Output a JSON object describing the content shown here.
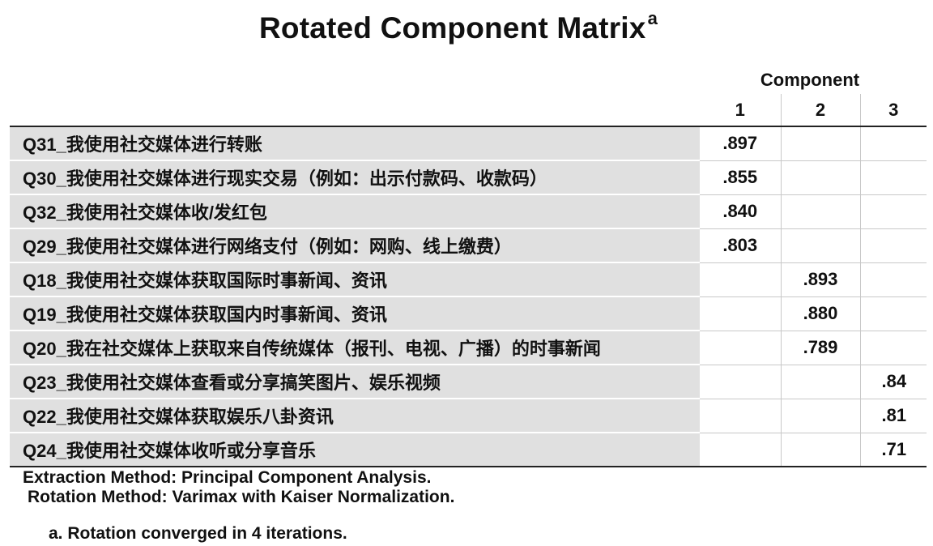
{
  "title": "Rotated Component Matrix",
  "title_superscript": "a",
  "component_header": "Component",
  "columns": [
    "1",
    "2",
    "3"
  ],
  "rows": [
    {
      "label": "Q31_我使用社交媒体进行转账",
      "values": [
        ".897",
        "",
        ""
      ]
    },
    {
      "label": "Q30_我使用社交媒体进行现实交易（例如：出示付款码、收款码）",
      "values": [
        ".855",
        "",
        ""
      ]
    },
    {
      "label": "Q32_我使用社交媒体收/发红包",
      "values": [
        ".840",
        "",
        ""
      ]
    },
    {
      "label": "Q29_我使用社交媒体进行网络支付（例如：网购、线上缴费）",
      "values": [
        ".803",
        "",
        ""
      ]
    },
    {
      "label": "Q18_我使用社交媒体获取国际时事新闻、资讯",
      "values": [
        "",
        ".893",
        ""
      ]
    },
    {
      "label": "Q19_我使用社交媒体获取国内时事新闻、资讯",
      "values": [
        "",
        ".880",
        ""
      ]
    },
    {
      "label": "Q20_我在社交媒体上获取来自传统媒体（报刊、电视、广播）的时事新闻",
      "values": [
        "",
        ".789",
        ""
      ]
    },
    {
      "label": "Q23_我使用社交媒体查看或分享搞笑图片、娱乐视频",
      "values": [
        "",
        "",
        ".84"
      ]
    },
    {
      "label": "Q22_我使用社交媒体获取娱乐八卦资讯",
      "values": [
        "",
        "",
        ".81"
      ]
    },
    {
      "label": "Q24_我使用社交媒体收听或分享音乐",
      "values": [
        "",
        "",
        ".71"
      ]
    }
  ],
  "footnotes": {
    "extraction": "Extraction Method: Principal Component Analysis.",
    "rotation": "Rotation Method: Varimax with Kaiser Normalization.",
    "note_a": "a. Rotation converged in 4 iterations."
  },
  "colors": {
    "label_background": "#e0e0e0",
    "rule": "#222222",
    "gridline": "#c8c8c8"
  }
}
